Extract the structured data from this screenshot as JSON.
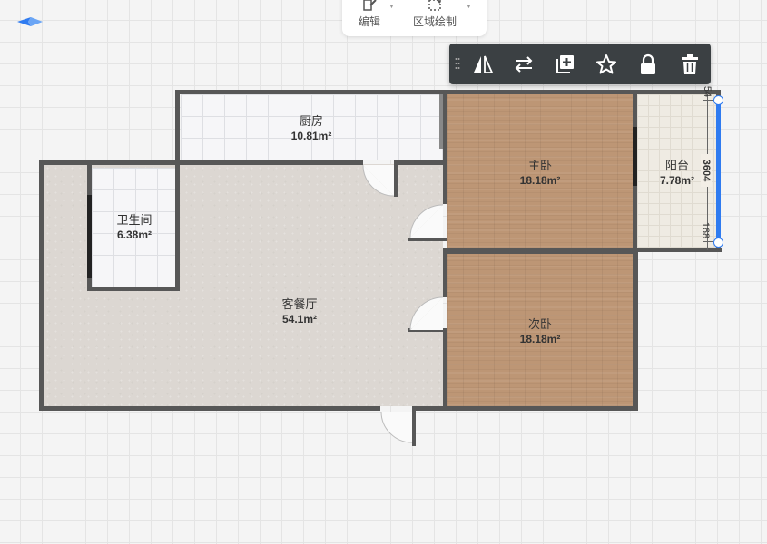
{
  "top_menu": {
    "edit_label": "编辑",
    "area_draw_label": "区域绘制"
  },
  "toolbar": {
    "buttons": [
      "mirror-icon",
      "swap-icon",
      "copy-icon",
      "favorite-icon",
      "lock-icon",
      "delete-icon"
    ]
  },
  "rooms": {
    "kitchen": {
      "name": "厨房",
      "area": "10.81m²"
    },
    "bathroom": {
      "name": "卫生间",
      "area": "6.38m²"
    },
    "living": {
      "name": "客餐厅",
      "area": "54.1m²"
    },
    "master_bedroom": {
      "name": "主卧",
      "area": "18.18m²"
    },
    "second_bedroom": {
      "name": "次卧",
      "area": "18.18m²"
    },
    "balcony": {
      "name": "阳台",
      "area": "7.78m²"
    }
  },
  "dimensions": {
    "top": "54",
    "main": "3604",
    "bottom": "168"
  },
  "colors": {
    "accent": "#2f7bf0",
    "wall": "#575757",
    "toolbar_bg": "#3b4043"
  }
}
